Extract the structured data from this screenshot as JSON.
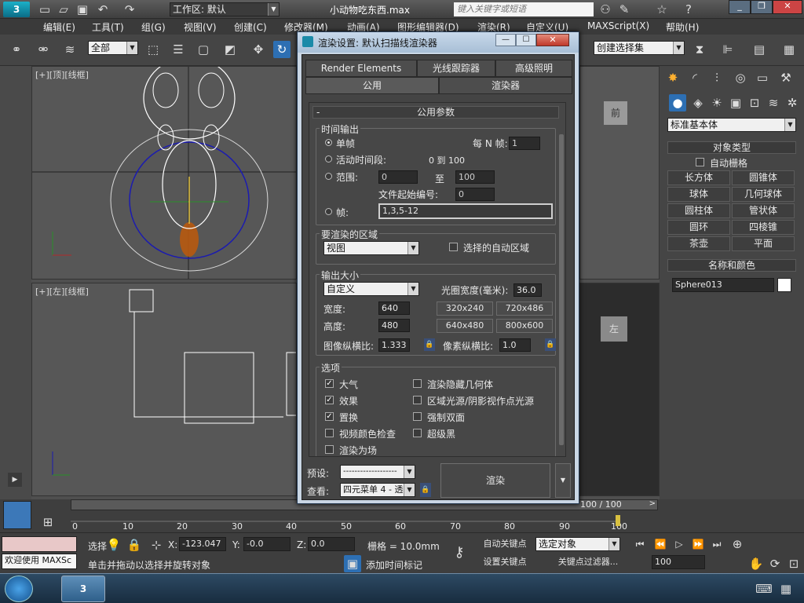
{
  "app": {
    "title": "小动物吃东西.max",
    "workspace": "工作区: 默认",
    "search_placeholder": "键入关键字或短语"
  },
  "menu": [
    "编辑(E)",
    "工具(T)",
    "组(G)",
    "视图(V)",
    "创建(C)",
    "修改器(M)",
    "动画(A)",
    "图形编辑器(D)",
    "渲染(R)",
    "自定义(U)",
    "MAXScript(X)",
    "帮助(H)"
  ],
  "toolbar": {
    "filter": "全部",
    "selection_set": "创建选择集"
  },
  "viewports": {
    "top": "[+][顶][线框]",
    "left": "[+][左][线框]",
    "front_label": "前",
    "left_label2": "左"
  },
  "command_panel": {
    "category": "标准基本体",
    "object_type_title": "对象类型",
    "auto_grid": "自动栅格",
    "objects": [
      "长方体",
      "圆锥体",
      "球体",
      "几何球体",
      "圆柱体",
      "管状体",
      "圆环",
      "四棱锥",
      "茶壶",
      "平面"
    ],
    "name_color_title": "名称和颜色",
    "object_name": "Sphere013"
  },
  "dialog": {
    "title": "渲染设置: 默认扫描线渲染器",
    "tabs_row1": [
      "Render Elements",
      "光线跟踪器",
      "高级照明"
    ],
    "tabs_row2": [
      "公用",
      "渲染器"
    ],
    "rollout": "公用参数",
    "time_output": {
      "title": "时间输出",
      "single": "单帧",
      "every_n": "每 N 帧:",
      "every_n_value": "1",
      "active_segment": "活动时间段:",
      "active_range": "0 到 100",
      "range": "范围:",
      "range_from": "0",
      "to": "至",
      "range_to": "100",
      "file_start": "文件起始编号:",
      "file_start_value": "0",
      "frames": "帧:",
      "frames_value": "1,3,5-12"
    },
    "area": {
      "title": "要渲染的区域",
      "value": "视图",
      "auto_region": "选择的自动区域"
    },
    "output_size": {
      "title": "输出大小",
      "preset": "自定义",
      "aperture_label": "光圈宽度(毫米):",
      "aperture": "36.0",
      "width_label": "宽度:",
      "width": "640",
      "height_label": "高度:",
      "height": "480",
      "presets": [
        "320x240",
        "720x486",
        "640x480",
        "800x600"
      ],
      "image_aspect_label": "图像纵横比:",
      "image_aspect": "1.333",
      "pixel_aspect_label": "像素纵横比:",
      "pixel_aspect": "1.0"
    },
    "options": {
      "title": "选项",
      "items": [
        [
          "大气",
          true
        ],
        [
          "效果",
          true
        ],
        [
          "置换",
          true
        ],
        [
          "视频颜色检查",
          false
        ],
        [
          "渲染为场",
          false
        ]
      ],
      "items_right": [
        [
          "渲染隐藏几何体",
          false
        ],
        [
          "区域光源/阴影视作点光源",
          false
        ],
        [
          "强制双面",
          false
        ],
        [
          "超级黑",
          false
        ]
      ]
    },
    "preset_label": "预设:",
    "preset_value": "-------------------",
    "view_label": "查看:",
    "view_value": "四元菜单 4 - 透",
    "render_button": "渲染"
  },
  "timeline": {
    "range_text": "100 / 100",
    "ticks": [
      "0",
      "10",
      "20",
      "30",
      "40",
      "50",
      "60",
      "70",
      "80",
      "90",
      "100"
    ]
  },
  "status": {
    "maxscript": "欢迎使用 MAXSc",
    "select_label": "选择",
    "x_label": "X:",
    "x": "-123.047",
    "y_label": "Y:",
    "y": "-0.0",
    "z_label": "Z:",
    "z": "0.0",
    "grid": "栅格 = 10.0mm",
    "auto_key": "自动关键点",
    "selected_object": "选定对象",
    "set_key": "设置关键点",
    "key_filter": "关键点过滤器...",
    "frame": "100",
    "prompt": "单击并拖动以选择并旋转对象",
    "add_time_tag": "添加时间标记"
  }
}
